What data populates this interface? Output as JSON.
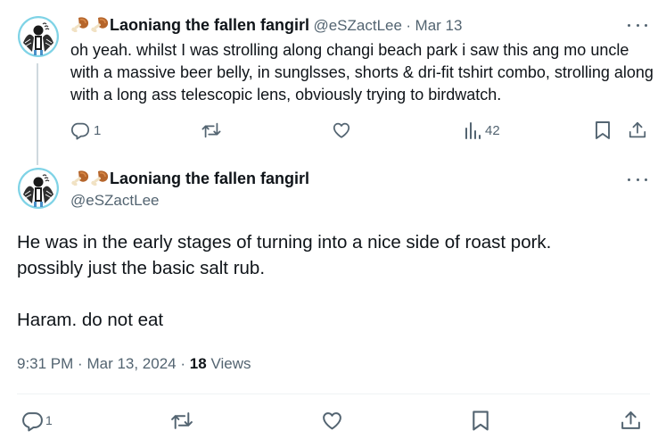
{
  "tweet1": {
    "author_name": "Laoniang the fallen fangirl",
    "handle": "@eSZactLee",
    "separator": "·",
    "date": "Mar 13",
    "text": "oh yeah. whilst I was strolling along changi beach park i saw this ang mo uncle with a massive beer belly, in sunglsses, shorts & dri-fit tshirt combo, strolling along with a long ass telescopic lens, obviously trying to birdwatch.",
    "reply_count": "1",
    "view_count": "42"
  },
  "tweet2": {
    "author_name": "Laoniang the fallen fangirl",
    "handle": "@eSZactLee",
    "paragraphs": [
      "He was in the early stages of turning into a nice side of roast pork.",
      "possibly just the basic salt rub.",
      "Haram. do not eat"
    ],
    "time": "9:31 PM",
    "meta_sep1": "·",
    "date": "Mar 13, 2024",
    "meta_sep2": "·",
    "views": "18",
    "views_label": "Views",
    "reply_count": "1"
  },
  "icons": {
    "emoji": "poultry-leg-emoji",
    "reply": "reply-icon",
    "retweet": "retweet-icon",
    "like": "heart-icon",
    "views": "analytics-icon",
    "bookmark": "bookmark-icon",
    "share": "share-icon",
    "more": "more-icon"
  },
  "colors": {
    "text": "#0f1419",
    "secondary": "#536471",
    "thread_line": "#cfd9de",
    "divider": "#eff3f4"
  }
}
